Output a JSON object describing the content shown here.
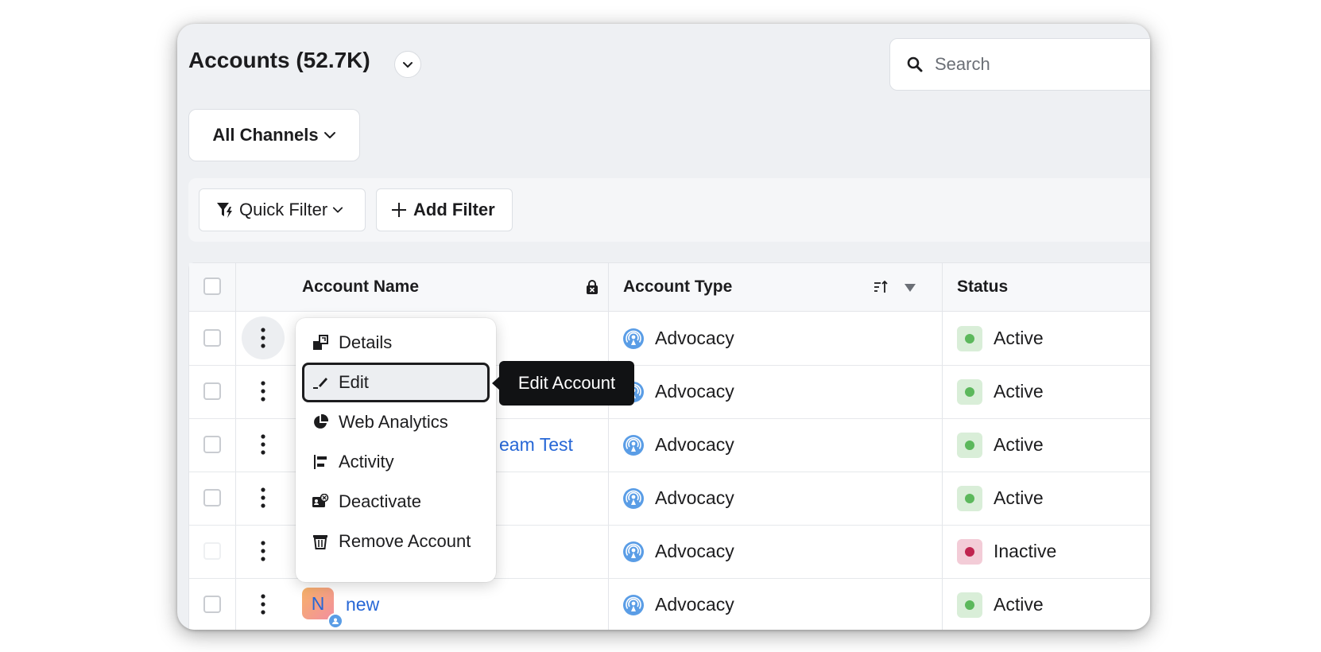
{
  "header": {
    "title": "Accounts (52.7K)",
    "search_placeholder": "Search"
  },
  "channels_button": "All Channels",
  "filters": {
    "quick_filter_label": "Quick Filter",
    "add_filter_label": "Add Filter"
  },
  "table": {
    "columns": {
      "account_name": "Account Name",
      "account_type": "Account Type",
      "status": "Status"
    },
    "rows": [
      {
        "name": "",
        "type": "Advocacy",
        "status": "Active"
      },
      {
        "name": "",
        "type": "Advocacy",
        "status": "Active"
      },
      {
        "name": "eam Test",
        "type": "Advocacy",
        "status": "Active"
      },
      {
        "name": "",
        "type": "Advocacy",
        "status": "Active"
      },
      {
        "name": "",
        "type": "Advocacy",
        "status": "Inactive"
      },
      {
        "name": "new",
        "avatar_letter": "N",
        "type": "Advocacy",
        "status": "Active"
      }
    ]
  },
  "context_menu": {
    "items": [
      {
        "label": "Details",
        "icon": "details-icon"
      },
      {
        "label": "Edit",
        "icon": "pencil-icon"
      },
      {
        "label": "Web Analytics",
        "icon": "pie-chart-icon"
      },
      {
        "label": "Activity",
        "icon": "activity-icon"
      },
      {
        "label": "Deactivate",
        "icon": "deactivate-icon"
      },
      {
        "label": "Remove Account",
        "icon": "trash-icon"
      }
    ],
    "selected_index": 1
  },
  "tooltip": "Edit Account",
  "colors": {
    "link": "#2767d6",
    "active_dot": "#5cb85c",
    "inactive_dot": "#c0244f",
    "advocacy_icon": "#5a9de6"
  }
}
